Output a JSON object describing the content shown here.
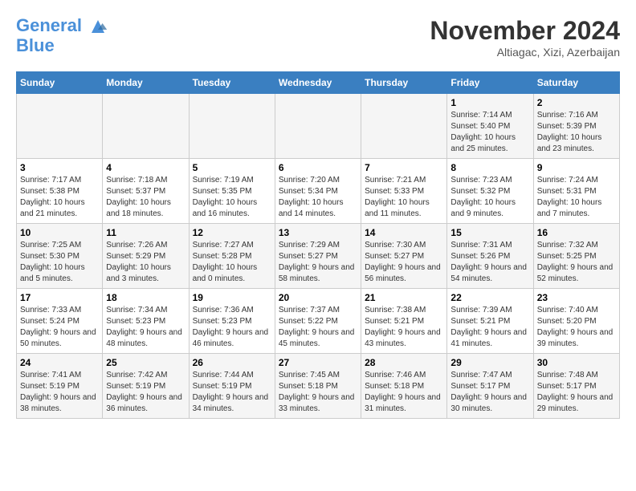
{
  "logo": {
    "line1": "General",
    "line2": "Blue"
  },
  "title": "November 2024",
  "location": "Altiagac, Xizi, Azerbaijan",
  "days_of_week": [
    "Sunday",
    "Monday",
    "Tuesday",
    "Wednesday",
    "Thursday",
    "Friday",
    "Saturday"
  ],
  "weeks": [
    [
      {
        "day": "",
        "info": ""
      },
      {
        "day": "",
        "info": ""
      },
      {
        "day": "",
        "info": ""
      },
      {
        "day": "",
        "info": ""
      },
      {
        "day": "",
        "info": ""
      },
      {
        "day": "1",
        "info": "Sunrise: 7:14 AM\nSunset: 5:40 PM\nDaylight: 10 hours and 25 minutes."
      },
      {
        "day": "2",
        "info": "Sunrise: 7:16 AM\nSunset: 5:39 PM\nDaylight: 10 hours and 23 minutes."
      }
    ],
    [
      {
        "day": "3",
        "info": "Sunrise: 7:17 AM\nSunset: 5:38 PM\nDaylight: 10 hours and 21 minutes."
      },
      {
        "day": "4",
        "info": "Sunrise: 7:18 AM\nSunset: 5:37 PM\nDaylight: 10 hours and 18 minutes."
      },
      {
        "day": "5",
        "info": "Sunrise: 7:19 AM\nSunset: 5:35 PM\nDaylight: 10 hours and 16 minutes."
      },
      {
        "day": "6",
        "info": "Sunrise: 7:20 AM\nSunset: 5:34 PM\nDaylight: 10 hours and 14 minutes."
      },
      {
        "day": "7",
        "info": "Sunrise: 7:21 AM\nSunset: 5:33 PM\nDaylight: 10 hours and 11 minutes."
      },
      {
        "day": "8",
        "info": "Sunrise: 7:23 AM\nSunset: 5:32 PM\nDaylight: 10 hours and 9 minutes."
      },
      {
        "day": "9",
        "info": "Sunrise: 7:24 AM\nSunset: 5:31 PM\nDaylight: 10 hours and 7 minutes."
      }
    ],
    [
      {
        "day": "10",
        "info": "Sunrise: 7:25 AM\nSunset: 5:30 PM\nDaylight: 10 hours and 5 minutes."
      },
      {
        "day": "11",
        "info": "Sunrise: 7:26 AM\nSunset: 5:29 PM\nDaylight: 10 hours and 3 minutes."
      },
      {
        "day": "12",
        "info": "Sunrise: 7:27 AM\nSunset: 5:28 PM\nDaylight: 10 hours and 0 minutes."
      },
      {
        "day": "13",
        "info": "Sunrise: 7:29 AM\nSunset: 5:27 PM\nDaylight: 9 hours and 58 minutes."
      },
      {
        "day": "14",
        "info": "Sunrise: 7:30 AM\nSunset: 5:27 PM\nDaylight: 9 hours and 56 minutes."
      },
      {
        "day": "15",
        "info": "Sunrise: 7:31 AM\nSunset: 5:26 PM\nDaylight: 9 hours and 54 minutes."
      },
      {
        "day": "16",
        "info": "Sunrise: 7:32 AM\nSunset: 5:25 PM\nDaylight: 9 hours and 52 minutes."
      }
    ],
    [
      {
        "day": "17",
        "info": "Sunrise: 7:33 AM\nSunset: 5:24 PM\nDaylight: 9 hours and 50 minutes."
      },
      {
        "day": "18",
        "info": "Sunrise: 7:34 AM\nSunset: 5:23 PM\nDaylight: 9 hours and 48 minutes."
      },
      {
        "day": "19",
        "info": "Sunrise: 7:36 AM\nSunset: 5:23 PM\nDaylight: 9 hours and 46 minutes."
      },
      {
        "day": "20",
        "info": "Sunrise: 7:37 AM\nSunset: 5:22 PM\nDaylight: 9 hours and 45 minutes."
      },
      {
        "day": "21",
        "info": "Sunrise: 7:38 AM\nSunset: 5:21 PM\nDaylight: 9 hours and 43 minutes."
      },
      {
        "day": "22",
        "info": "Sunrise: 7:39 AM\nSunset: 5:21 PM\nDaylight: 9 hours and 41 minutes."
      },
      {
        "day": "23",
        "info": "Sunrise: 7:40 AM\nSunset: 5:20 PM\nDaylight: 9 hours and 39 minutes."
      }
    ],
    [
      {
        "day": "24",
        "info": "Sunrise: 7:41 AM\nSunset: 5:19 PM\nDaylight: 9 hours and 38 minutes."
      },
      {
        "day": "25",
        "info": "Sunrise: 7:42 AM\nSunset: 5:19 PM\nDaylight: 9 hours and 36 minutes."
      },
      {
        "day": "26",
        "info": "Sunrise: 7:44 AM\nSunset: 5:19 PM\nDaylight: 9 hours and 34 minutes."
      },
      {
        "day": "27",
        "info": "Sunrise: 7:45 AM\nSunset: 5:18 PM\nDaylight: 9 hours and 33 minutes."
      },
      {
        "day": "28",
        "info": "Sunrise: 7:46 AM\nSunset: 5:18 PM\nDaylight: 9 hours and 31 minutes."
      },
      {
        "day": "29",
        "info": "Sunrise: 7:47 AM\nSunset: 5:17 PM\nDaylight: 9 hours and 30 minutes."
      },
      {
        "day": "30",
        "info": "Sunrise: 7:48 AM\nSunset: 5:17 PM\nDaylight: 9 hours and 29 minutes."
      }
    ]
  ]
}
